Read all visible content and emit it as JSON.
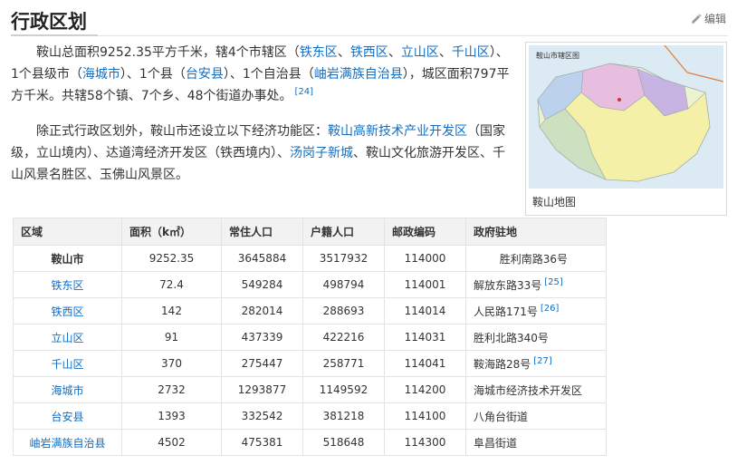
{
  "section": {
    "title": "行政区划",
    "edit_label": "编辑"
  },
  "paragraph1": {
    "t1": "鞍山总面积9252.35平方千米，辖4个市辖区（",
    "l1": "铁东区",
    "s1": "、",
    "l2": "铁西区",
    "s2": "、",
    "l3": "立山区",
    "s3": "、",
    "l4": "千山区",
    "t2": "）、1个县级市（",
    "l5": "海城市",
    "t3": "）、1个县（",
    "l6": "台安县",
    "t4": "）、1个自治县（",
    "l7": "岫岩满族自治县",
    "t5": "），城区面积797平方千米。共辖58个镇、7个乡、48个街道办事处。",
    "ref": "[24]"
  },
  "paragraph2": {
    "t1": "除正式行政区划外，鞍山市还设立以下经济功能区：",
    "l1": "鞍山高新技术产业开发区",
    "t2": "（国家级，立山境内）、达道湾经济开发区（铁西境内）、",
    "l2": "汤岗子新城",
    "t3": "、鞍山文化旅游开发区、千山风景名胜区、玉佛山风景区。"
  },
  "map": {
    "title": "鞍山市辖区图",
    "caption": "鞍山地图"
  },
  "table": {
    "headers": [
      "区域",
      "面积（k㎡）",
      "常住人口",
      "户籍人口",
      "邮政编码",
      "政府驻地"
    ],
    "rows": [
      {
        "name": "鞍山市",
        "area": "9252.35",
        "resident": "3645884",
        "registered": "3517932",
        "postcode": "114000",
        "seat": "胜利南路36号",
        "ref": ""
      },
      {
        "name": "铁东区",
        "area": "72.4",
        "resident": "549284",
        "registered": "498794",
        "postcode": "114001",
        "seat": "解放东路33号",
        "ref": "[25]"
      },
      {
        "name": "铁西区",
        "area": "142",
        "resident": "282014",
        "registered": "288693",
        "postcode": "114014",
        "seat": "人民路171号",
        "ref": "[26]"
      },
      {
        "name": "立山区",
        "area": "91",
        "resident": "437339",
        "registered": "422216",
        "postcode": "114031",
        "seat": "胜利北路340号",
        "ref": ""
      },
      {
        "name": "千山区",
        "area": "370",
        "resident": "275447",
        "registered": "258771",
        "postcode": "114041",
        "seat": "鞍海路28号",
        "ref": "[27]"
      },
      {
        "name": "海城市",
        "area": "2732",
        "resident": "1293877",
        "registered": "1149592",
        "postcode": "114200",
        "seat": "海城市经济技术开发区",
        "ref": ""
      },
      {
        "name": "台安县",
        "area": "1393",
        "resident": "332542",
        "registered": "381218",
        "postcode": "114100",
        "seat": "八角台街道",
        "ref": ""
      },
      {
        "name": "岫岩满族自治县",
        "area": "4502",
        "resident": "475381",
        "registered": "518648",
        "postcode": "114300",
        "seat": "阜昌街道",
        "ref": ""
      }
    ]
  },
  "colors": {
    "link": "#136ec2",
    "header_bg": "#f2f2f2",
    "border": "#e3e3e3"
  }
}
